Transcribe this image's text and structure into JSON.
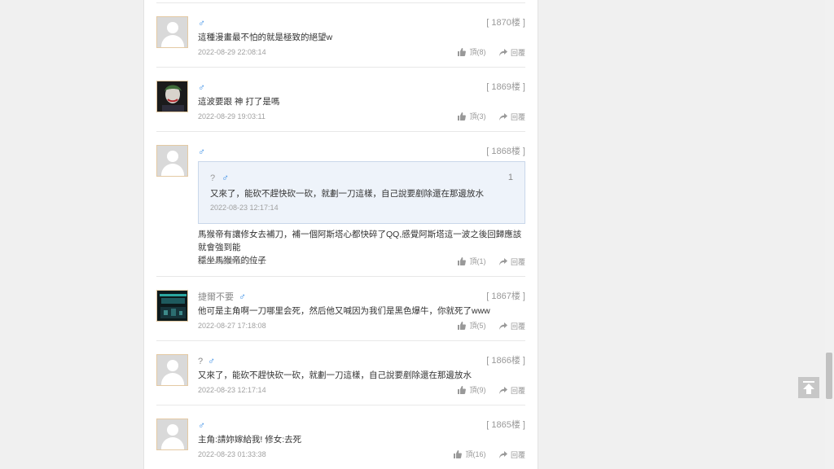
{
  "comments": [
    {
      "name": "",
      "gender": "♂",
      "floor": "[ 1870楼 ]",
      "text": "這種漫畫最不怕的就是極致的絕望w",
      "time": "2022-08-29 22:08:14",
      "like": "頂(8)",
      "reply": "回覆"
    },
    {
      "name": "",
      "gender": "♂",
      "floor": "[ 1869楼 ]",
      "text": "這波要跟 神 打了是嗎",
      "time": "2022-08-29 19:03:11",
      "like": "頂(3)",
      "reply": "回覆"
    },
    {
      "name": "",
      "gender": "♂",
      "floor": "[ 1868楼 ]",
      "text_line1": "馬猴帝有讓修女去補刀，補一個阿斯塔心都快碎了QQ,感覺阿斯塔這一波之後回歸應該就會強到能",
      "text_line2": "穩坐馬猴帝的位子",
      "time": "2022-08-29 14:59:51",
      "like": "頂(1)",
      "reply": "回覆",
      "quote": {
        "name": "?",
        "gender": "♂",
        "index": "1",
        "text": "又來了，能砍不趕快砍一砍，就劃一刀這樣，自己說要剷除還在那邊放水",
        "time": "2022-08-23 12:17:14"
      }
    },
    {
      "name": "捷爾不要",
      "gender": "♂",
      "floor": "[ 1867楼 ]",
      "text": "他可是主角啊一刀哪里会死，然后他又喊因为我们是黑色爆牛，你就死了www",
      "time": "2022-08-27 17:18:08",
      "like": "頂(5)",
      "reply": "回覆"
    },
    {
      "name": "?",
      "gender": "♂",
      "floor": "[ 1866楼 ]",
      "text": "又來了，能砍不趕快砍一砍，就劃一刀這樣，自己說要剷除還在那邊放水",
      "time": "2022-08-23 12:17:14",
      "like": "頂(9)",
      "reply": "回覆"
    },
    {
      "name": "",
      "gender": "♂",
      "floor": "[ 1865楼 ]",
      "text": "主角:請妳嫁給我! 修女:去死",
      "time": "2022-08-23 01:33:38",
      "like": "頂(16)",
      "reply": "回覆"
    }
  ],
  "icons": {
    "like": "thumbs-up-icon",
    "reply": "share-arrow-icon",
    "totop": "arrow-up-icon"
  },
  "colors": {
    "male": "#3a8ee6",
    "quote_bg": "#eef3fa"
  }
}
